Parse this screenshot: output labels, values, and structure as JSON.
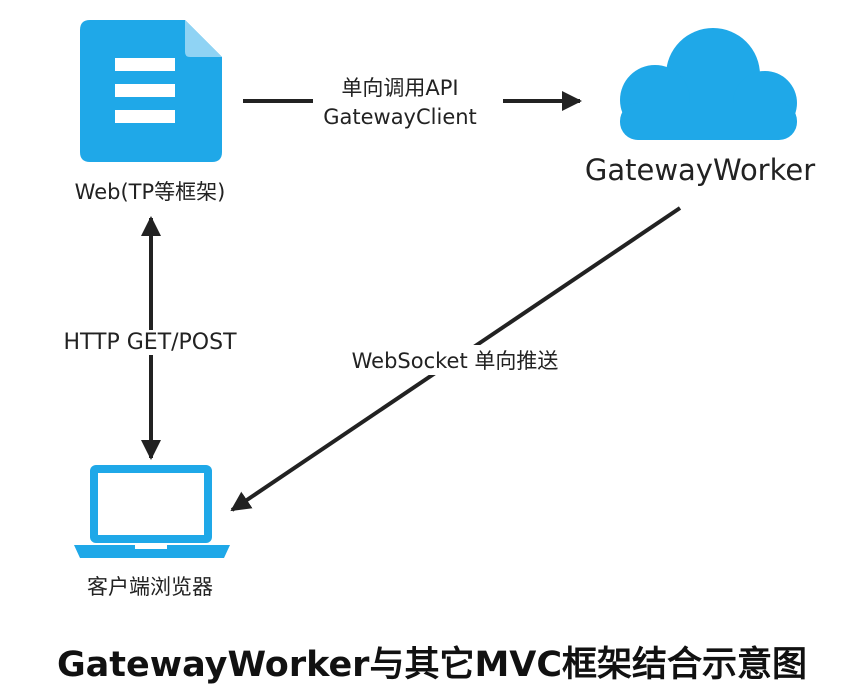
{
  "colors": {
    "icon_blue": "#1FA8E8",
    "arrow": "#222222",
    "text": "#222222"
  },
  "icons": {
    "web": "document-icon",
    "gateway": "cloud-icon",
    "browser": "laptop-icon"
  },
  "nodes": {
    "web": "Web(TP等框架)",
    "gateway": "GatewayWorker",
    "browser": "客户端浏览器"
  },
  "edges": {
    "api_line1": "单向调用API",
    "api_line2": "GatewayClient",
    "http": "HTTP GET/POST",
    "websocket": "WebSocket 单向推送"
  },
  "caption": "GatewayWorker与其它MVC框架结合示意图"
}
